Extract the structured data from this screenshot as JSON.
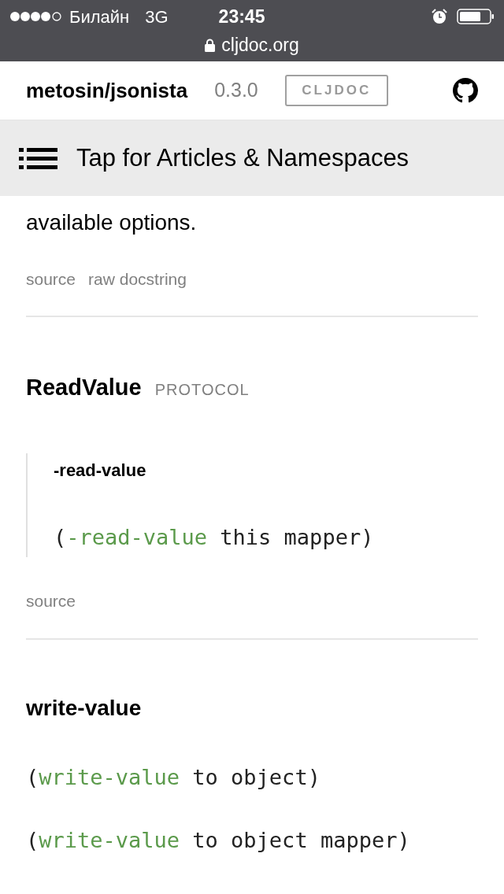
{
  "status_bar": {
    "carrier": "Билайн",
    "network": "3G",
    "time": "23:45"
  },
  "url_bar": {
    "url": "cljdoc.org"
  },
  "header": {
    "project": "metosin/jsonista",
    "version": "0.3.0",
    "badge": "CLJDOC"
  },
  "nav_bar": {
    "label": "Tap for Articles & Namespaces"
  },
  "intro": {
    "text": "available options.",
    "links": [
      "source",
      "raw docstring"
    ]
  },
  "protocol": {
    "name": "ReadValue",
    "tag": "PROTOCOL",
    "methods": [
      {
        "name": "-read-value",
        "signatures": [
          [
            {
              "text": "(",
              "kind": "plain"
            },
            {
              "text": "-read-value",
              "kind": "fn"
            },
            {
              "text": " this mapper)",
              "kind": "plain"
            }
          ]
        ]
      }
    ],
    "links": [
      "source"
    ]
  },
  "function": {
    "name": "write-value",
    "signatures": [
      [
        {
          "text": "(",
          "kind": "plain"
        },
        {
          "text": "write-value",
          "kind": "fn"
        },
        {
          "text": " to object)",
          "kind": "plain"
        }
      ],
      [
        {
          "text": "(",
          "kind": "plain"
        },
        {
          "text": "write-value",
          "kind": "fn"
        },
        {
          "text": " to object mapper)",
          "kind": "plain"
        }
      ]
    ]
  }
}
